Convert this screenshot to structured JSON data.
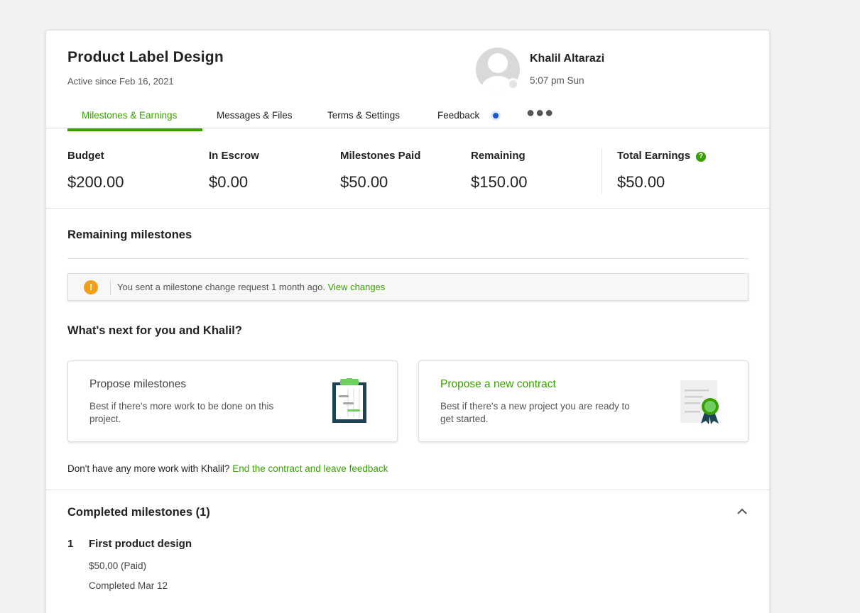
{
  "contract": {
    "title": "Product Label Design",
    "active_since": "Active since Feb 16, 2021"
  },
  "client": {
    "name": "Khalil Altarazi",
    "local_time": "5:07 pm Sun"
  },
  "tabs": [
    {
      "label": "Milestones & Earnings",
      "active": true
    },
    {
      "label": "Messages & Files",
      "active": false
    },
    {
      "label": "Terms & Settings",
      "active": false
    },
    {
      "label": "Feedback",
      "active": false,
      "has_dot": true
    }
  ],
  "more_menu_icon": "more-dots-icon",
  "stats": [
    {
      "label": "Budget",
      "value": "$200.00"
    },
    {
      "label": "In Escrow",
      "value": "$0.00"
    },
    {
      "label": "Milestones Paid",
      "value": "$50.00"
    },
    {
      "label": "Remaining",
      "value": "$150.00"
    },
    {
      "label": "Total Earnings",
      "value": "$50.00",
      "help_icon": "question-icon"
    }
  ],
  "remaining": {
    "title": "Remaining milestones",
    "alert": {
      "icon": "warning-icon",
      "text": "You sent a milestone change request 1 month ago.",
      "link": "View changes"
    }
  },
  "next": {
    "title": "What's next for you and Khalil?",
    "options": [
      {
        "title": "Propose milestones",
        "description": "Best if there's more work to be done on this project.",
        "icon": "clipboard-icon"
      },
      {
        "title": "Propose a new contract",
        "description": "Best if there's a new project you are ready to get started.",
        "icon": "certificate-icon"
      }
    ],
    "end_prompt": "Don't have any more work with Khalil?",
    "end_link": "End the contract and leave feedback"
  },
  "completed": {
    "title": "Completed milestones (1)",
    "items": [
      {
        "number": "1",
        "name": "First product design",
        "amount": "$50,00 (Paid)",
        "completed": "Completed Mar 12"
      }
    ]
  },
  "colors": {
    "accent": "#37a000",
    "warning": "#f1a01a",
    "notification": "#1f57c3",
    "page_bg": "#f2f2f3"
  }
}
